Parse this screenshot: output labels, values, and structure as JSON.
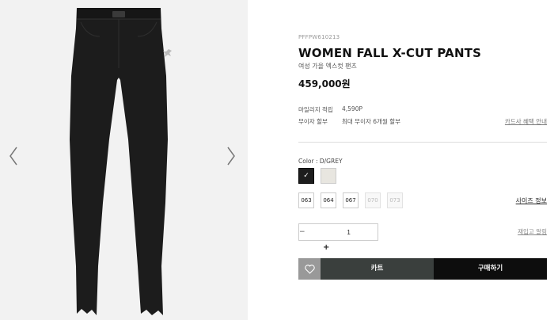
{
  "gallery": {
    "prev_icon": "chevron-left-icon",
    "next_icon": "chevron-right-icon",
    "background": "#f2f2f2",
    "product_color": "#1c1c1c"
  },
  "product": {
    "sku": "PFFPW610213",
    "title": "WOMEN FALL X-CUT PANTS",
    "subtitle": "여성 가을 엑스컷 팬츠",
    "price": "459,000원"
  },
  "benefits": {
    "mileage_label": "마일리지 적립",
    "mileage_value": "4,590P",
    "installment_label": "무이자 할부",
    "installment_value": "최대 무이자 6개월 할부",
    "card_link": "카드사 혜택 안내"
  },
  "options": {
    "color_label": "Color : D/GREY",
    "selected_check": "✓",
    "swatches": [
      {
        "color": "#1d1d1d",
        "selected": true
      },
      {
        "color": "#e8e6e0",
        "selected": false
      }
    ],
    "sizes": [
      {
        "label": "063",
        "available": true
      },
      {
        "label": "064",
        "available": true
      },
      {
        "label": "067",
        "available": true
      },
      {
        "label": "070",
        "available": false
      },
      {
        "label": "073",
        "available": false
      }
    ],
    "size_guide": "사이즈 정보"
  },
  "quantity": {
    "minus": "−",
    "value": "1",
    "plus": "+",
    "restock": "재입고 알림"
  },
  "actions": {
    "wishlist_icon": "heart-icon",
    "cart": "카트",
    "buy": "구매하기",
    "cart_color": "#3a3f3d",
    "buy_color": "#0d0d0d"
  }
}
